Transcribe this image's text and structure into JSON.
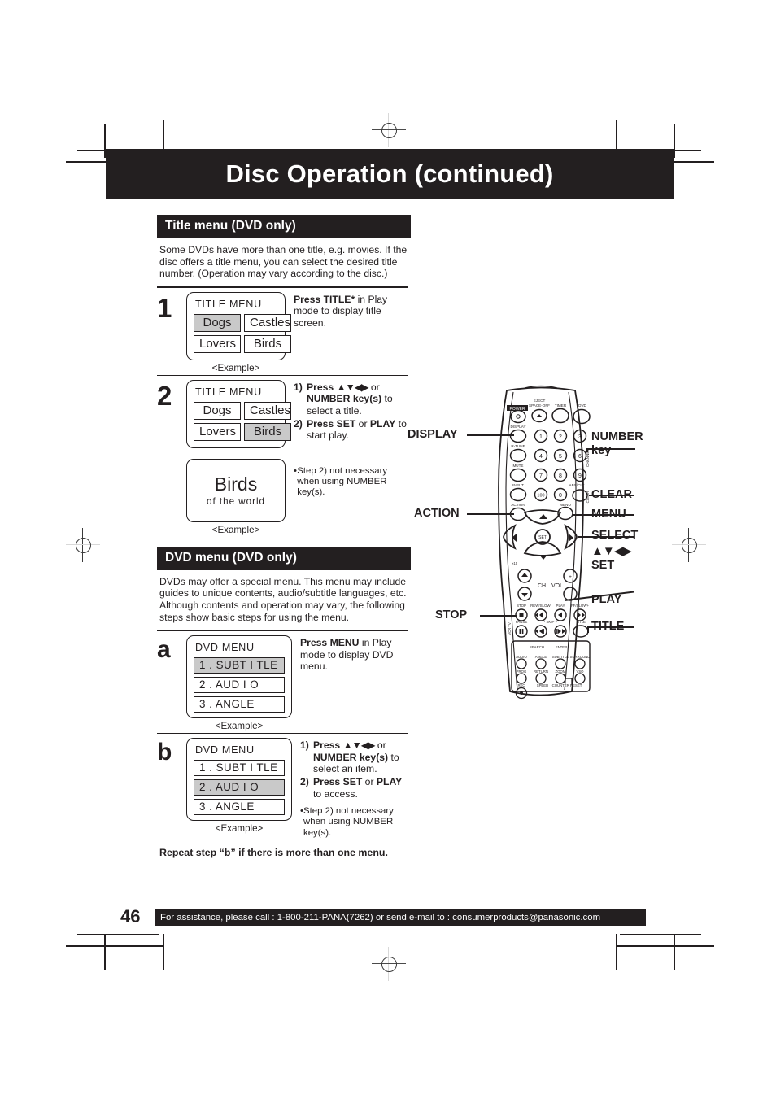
{
  "page": {
    "banner_title": "Disc Operation (continued)",
    "number": "46",
    "footer": "For assistance, please call : 1-800-211-PANA(7262) or send e-mail to : consumerproducts@panasonic.com",
    "example_label": "<Example>"
  },
  "title_menu_section": {
    "heading": "Title menu (DVD only)",
    "intro": "Some DVDs have more than one title, e.g. movies. If the disc offers a title menu, you can select the desired title number. (Operation may vary according to the disc.)",
    "step1": {
      "number": "1",
      "osd_title": "TITLE  MENU",
      "cells": [
        "Dogs",
        "Castles",
        "Lovers",
        "Birds"
      ],
      "selected": "Dogs",
      "instruction_bold": "Press TITLE*",
      "instruction_rest": " in Play mode to display title screen."
    },
    "step2": {
      "number": "2",
      "osd_title": "TITLE  MENU",
      "cells": [
        "Dogs",
        "Castles",
        "Lovers",
        "Birds"
      ],
      "selected": "Birds",
      "play_screen_title": "Birds",
      "play_screen_subtitle": "of  the  world",
      "instruction_1_num": "1)",
      "instruction_1_bold": "Press ",
      "instruction_1_arrows": "▲▼◀▶",
      "instruction_1_mid": " or ",
      "instruction_1_bold2": "NUMBER key(s)",
      "instruction_1_rest": " to select a title.",
      "instruction_2_num": "2)",
      "instruction_2_bold": "Press SET",
      "instruction_2_mid": " or ",
      "instruction_2_bold2": "PLAY",
      "instruction_2_rest": " to start play.",
      "note": "Step 2) not necessary when using NUMBER key(s)."
    }
  },
  "dvd_menu_section": {
    "heading": "DVD menu (DVD only)",
    "intro": "DVDs may offer a special menu. This menu may include guides to unique contents, audio/subtitle languages, etc. Although contents and operation may vary, the following steps show basic steps for using the menu.",
    "step_a": {
      "number": "a",
      "osd_title": "DVD MENU",
      "items": [
        "1 . SUBT I TLE",
        "2 . AUD I O",
        "3 . ANGLE"
      ],
      "selected_index": 0,
      "instruction_bold": "Press MENU",
      "instruction_rest": " in Play mode to display DVD menu."
    },
    "step_b": {
      "number": "b",
      "osd_title": "DVD MENU",
      "items": [
        "1 . SUBT I TLE",
        "2 . AUD I O",
        "3 . ANGLE"
      ],
      "selected_index": 1,
      "instruction_1_num": "1)",
      "instruction_1_bold": "Press ",
      "instruction_1_arrows": "▲▼◀▶",
      "instruction_1_mid": " or ",
      "instruction_1_bold2": "NUMBER key(s)",
      "instruction_1_rest": " to select an item.",
      "instruction_2_num": "2)",
      "instruction_2_bold": "Press SET",
      "instruction_2_mid": " or ",
      "instruction_2_bold2": "PLAY",
      "instruction_2_rest": " to access.",
      "note": "Step 2) not necessary when using NUMBER key(s)."
    },
    "repeat_note": "Repeat step “b” if there is more than one menu."
  },
  "remote": {
    "callouts_left": [
      {
        "label": "DISPLAY"
      },
      {
        "label": "ACTION"
      },
      {
        "label": "STOP"
      }
    ],
    "callouts_right": [
      {
        "label": "NUMBER"
      },
      {
        "label": "key"
      },
      {
        "label": "CLEAR"
      },
      {
        "label": "MENU"
      },
      {
        "label": "SELECT"
      },
      {
        "label": "▲▼◀▶"
      },
      {
        "label": "SET"
      },
      {
        "label": "PLAY"
      },
      {
        "label": "TITLE"
      }
    ],
    "button_labels": {
      "power": "POWER",
      "eject": "EJECT SPACE-OFF",
      "timer": "TIMER",
      "dvd": "DVD",
      "display": "DISPLAY",
      "rtune": "R-TUNE",
      "mute": "MUTE",
      "input": "INPUT",
      "action": "ACTION",
      "menu": "MENU",
      "absolute": "ABS/CLT",
      "clear": "CLEAR",
      "channel": "CHANNEL",
      "ch": "CH",
      "vol": "VOL",
      "set": "SET",
      "stop": "STOP",
      "rew": "REW/SLOW-",
      "play": "PLAY",
      "ff": "FF/SLOW+",
      "pause": "PAUSE",
      "skip": "-  SKIP  +",
      "title": "TITLE",
      "search": "SEARCH   ENTER",
      "audio": "AUDIO",
      "angle": "ANGLE",
      "subtitle": "SUBTITLE",
      "surround": "SURROUND",
      "prog": "PROG",
      "return": "RETURN",
      "zoom": "ZOOM",
      "vso": "VSO",
      "rec": "REC",
      "speed": "SPEED",
      "counter_reset": "COUNTER RESET"
    },
    "numbers": [
      "1",
      "2",
      "3",
      "4",
      "5",
      "6",
      "7",
      "8",
      "9",
      "100",
      "0"
    ]
  }
}
